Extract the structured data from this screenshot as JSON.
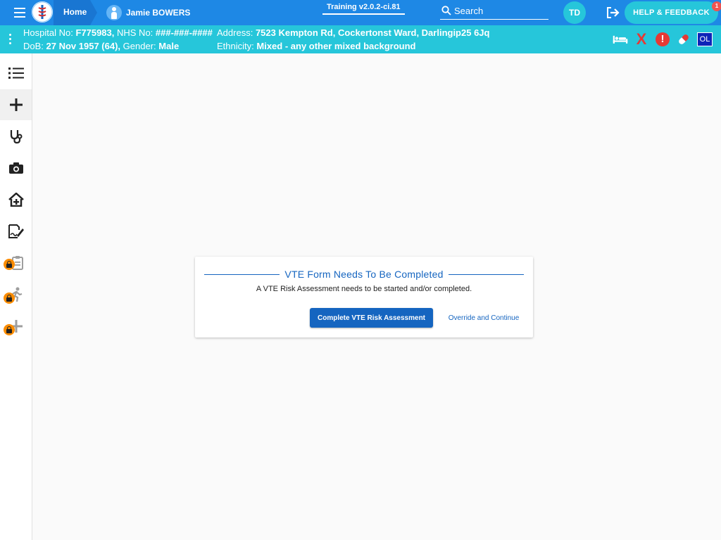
{
  "colors": {
    "topbar": "#1e88e5",
    "banner": "#26c6da",
    "primary": "#1565c0",
    "alert": "#e53935",
    "lock": "#fb8c00"
  },
  "topbar": {
    "home_label": "Home",
    "patient_name": "Jamie BOWERS",
    "build": "Training v2.0.2-ci.81",
    "search_label": "Search",
    "user_initials": "TD",
    "help_label": "HELP & FEEDBACK",
    "help_badge": "1",
    "icons": [
      "menu-icon",
      "app-logo",
      "patient-icon",
      "search-icon",
      "logout-icon"
    ]
  },
  "banner": {
    "hospital_no_label": "Hospital No:",
    "hospital_no": "F775983,",
    "nhs_no_label": "NHS No:",
    "nhs_no": "###-###-####",
    "dob_label": "DoB:",
    "dob": "27 Nov 1957 (64),",
    "gender_label": "Gender:",
    "gender": "Male",
    "address_label": "Address:",
    "address": "7523 Kempton Rd, Cockertonst Ward, Darlingip25 6Jq",
    "ethnicity_label": "Ethnicity:",
    "ethnicity": "Mixed - any other mixed background",
    "ol_label": "OL",
    "x_label": "X",
    "alert_label": "!",
    "icons": [
      "bed-icon",
      "x-icon",
      "alert-icon",
      "pill-icon",
      "ol-badge"
    ]
  },
  "sidebar": {
    "items": [
      {
        "icon": "list-icon",
        "active": false,
        "locked": false
      },
      {
        "icon": "plus-icon",
        "active": true,
        "locked": false
      },
      {
        "icon": "stethoscope-icon",
        "active": false,
        "locked": false
      },
      {
        "icon": "camera-icon",
        "active": false,
        "locked": false
      },
      {
        "icon": "home-plus-icon",
        "active": false,
        "locked": false
      },
      {
        "icon": "signature-icon",
        "active": false,
        "locked": false
      },
      {
        "icon": "clipboard-icon",
        "active": false,
        "locked": true
      },
      {
        "icon": "walking-icon",
        "active": false,
        "locked": true
      },
      {
        "icon": "plus-icon",
        "active": false,
        "locked": true
      }
    ]
  },
  "dialog": {
    "title": "VTE Form Needs To Be Completed",
    "message": "A VTE Risk Assessment needs to be started and/or completed.",
    "primary_button": "Complete VTE Risk Assessment",
    "secondary_button": "Override and Continue"
  }
}
